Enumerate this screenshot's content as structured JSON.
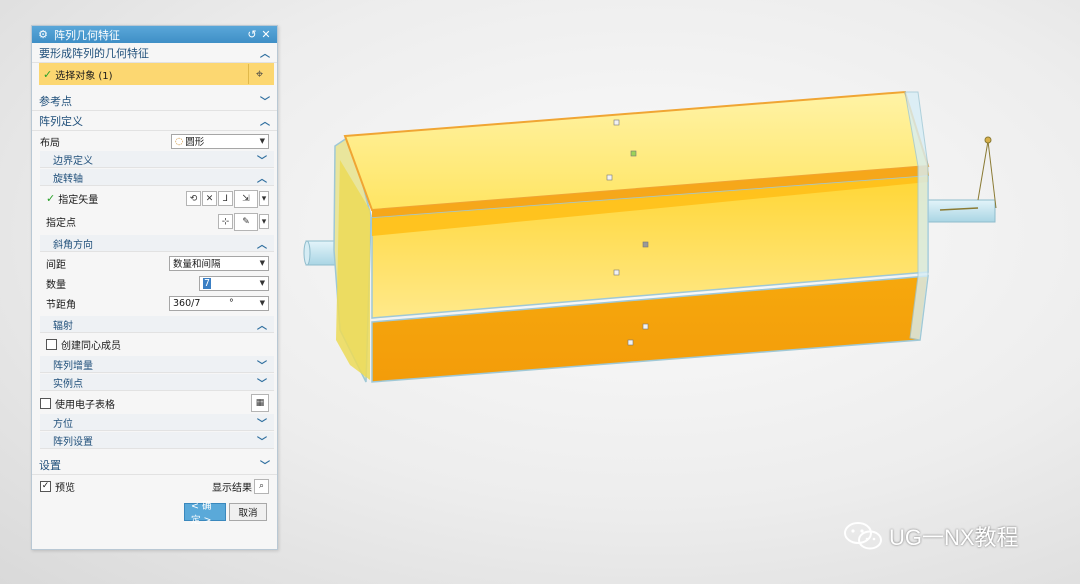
{
  "dialog": {
    "title": "阵列几何特征",
    "sections": {
      "geometry": {
        "label": "要形成阵列的几何特征",
        "select_label": "选择对象 (1)"
      },
      "reference_point": {
        "label": "参考点"
      },
      "pattern_definition": {
        "label": "阵列定义",
        "layout_label": "布局",
        "layout_value": "圆形",
        "boundary_label": "边界定义",
        "rotation_axis": {
          "label": "旋转轴",
          "vector_label": "指定矢量",
          "point_label": "指定点"
        },
        "angular_direction": {
          "label": "斜角方向",
          "spacing_label": "间距",
          "spacing_value": "数量和间隔",
          "count_label": "数量",
          "count_value": "7",
          "pitch_label": "节距角",
          "pitch_value": "360/7",
          "pitch_unit": "°"
        },
        "radial": {
          "label": "辐射",
          "concentric_label": "创建同心成员"
        },
        "increment_label": "阵列增量",
        "instance_label": "实例点",
        "spreadsheet_label": "使用电子表格",
        "orientation_label": "方位",
        "settings_label": "阵列设置"
      },
      "settings": {
        "label": "设置"
      }
    },
    "preview_label": "预览",
    "show_result_label": "显示结果",
    "ok_label": "< 确定 >",
    "cancel_label": "取消"
  },
  "watermark": {
    "text": "UG一NX教程"
  },
  "colors": {
    "title_bar": "#4a9bd1",
    "selection_highlight": "#fcd771",
    "body_orange": "#f5a514",
    "body_yellow": "#ffe97a",
    "shaft": "#bfe3ef"
  },
  "icons": {
    "title": "gear-icon",
    "reset": "reset-icon",
    "close": "close-icon",
    "select": "crosshair-icon",
    "expand": "chevron-down-icon",
    "collapse": "chevron-up-icon"
  }
}
